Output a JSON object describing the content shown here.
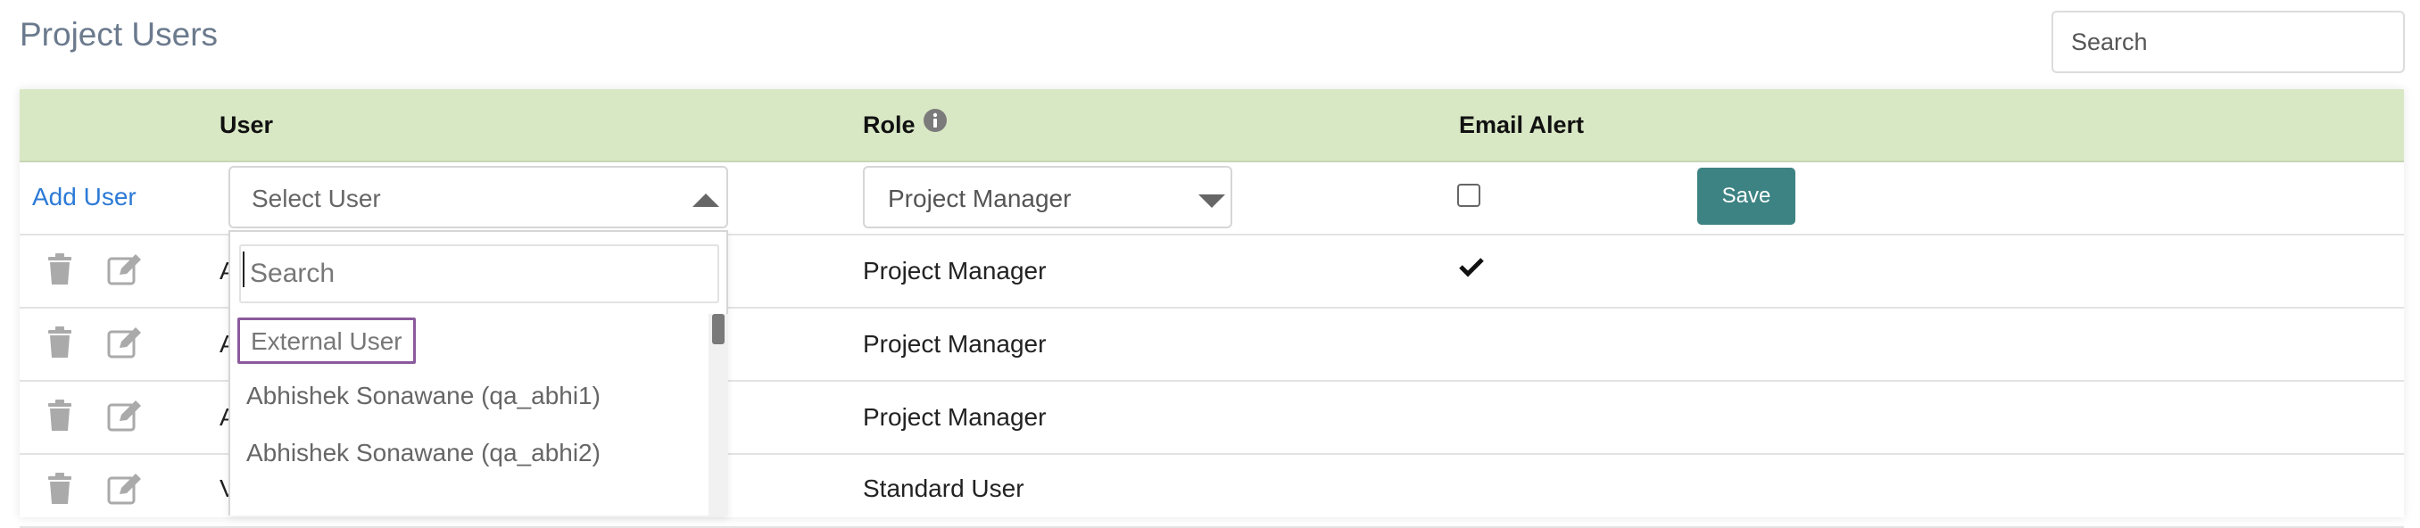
{
  "page": {
    "title": "Project Users"
  },
  "search": {
    "placeholder": "Search"
  },
  "table": {
    "headers": {
      "user": "User",
      "role": "Role",
      "email_alert": "Email Alert"
    },
    "add_row": {
      "add_user_label": "Add User",
      "select_user_placeholder": "Select User",
      "role_value": "Project Manager",
      "email_alert_checked": false,
      "save_label": "Save"
    },
    "rows": [
      {
        "user_initial": "A",
        "role": "Project Manager",
        "email_alert": true
      },
      {
        "user_initial": "A",
        "role": "Project Manager",
        "email_alert": false
      },
      {
        "user_initial": "A",
        "role": "Project Manager",
        "email_alert": false
      },
      {
        "user_initial": "V",
        "role": "Standard User",
        "email_alert": false
      }
    ]
  },
  "dropdown": {
    "search_placeholder": "Search",
    "options": [
      "External User",
      "Abhishek Sonawane (qa_abhi1)",
      "Abhishek Sonawane (qa_abhi2)"
    ],
    "highlighted_index": 0
  },
  "icons": {
    "info": "info-icon",
    "trash": "trash-icon",
    "edit": "edit-icon",
    "check": "checkmark-icon",
    "caret_up": "caret-up-icon",
    "caret_down": "caret-down-icon"
  },
  "colors": {
    "header_bg": "#d9e8c4",
    "save_button": "#3e8383",
    "link": "#2d7ad6",
    "highlight_border": "#8b5a9c",
    "title": "#6b7a8d"
  }
}
